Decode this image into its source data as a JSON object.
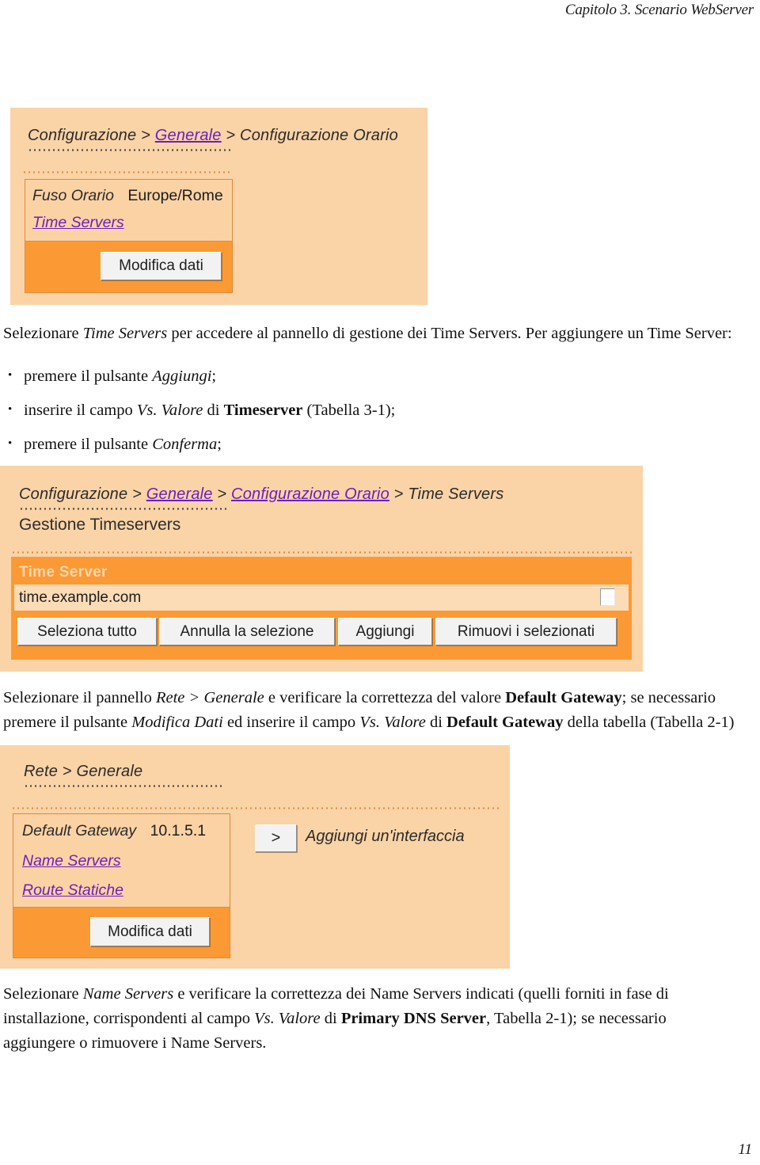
{
  "running_head": "Capitolo 3. Scenario WebServer",
  "page_number": "11",
  "screenshot_timeconfig": {
    "breadcrumb": {
      "part1": "Configurazione",
      "sep1": " > ",
      "link1": "Generale",
      "sep2": " > ",
      "part2": "Configurazione Orario"
    },
    "timezone_label": "Fuso Orario",
    "timezone_value": "Europe/Rome",
    "time_servers_link": "Time Servers",
    "edit_button": "Modifica dati"
  },
  "screenshot_timeservers": {
    "breadcrumb": {
      "part1": "Configurazione",
      "sep1": " > ",
      "link1": "Generale",
      "sep2": " > ",
      "link2": "Configurazione Orario",
      "sep3": " > ",
      "part2": "Time Servers"
    },
    "panel_title": "Gestione Timeservers",
    "table": {
      "header": "Time Server",
      "rows": [
        {
          "server": "time.example.com",
          "selected": false
        }
      ]
    },
    "buttons": [
      "Seleziona tutto",
      "Annulla la selezione",
      "Aggiungi",
      "Rimuovi i selezionati"
    ]
  },
  "screenshot_network": {
    "breadcrumb": {
      "part1": "Rete",
      "sep1": " > ",
      "part2": "Generale"
    },
    "gateway_label": "Default Gateway",
    "gateway_value": "10.1.5.1",
    "name_servers_link": "Name Servers",
    "static_routes_link": "Route Statiche",
    "edit_button": "Modifica dati",
    "add_interface_arrow": ">",
    "add_interface_label": "Aggiungi un'interfaccia"
  },
  "paragraphs": {
    "p1": {
      "s1": "Selezionare ",
      "i1": "Time Servers",
      "s2": " per accedere al pannello di gestione dei Time Servers. Per aggiungere un Time Server:"
    },
    "bullets": [
      {
        "s1": "premere il pulsante ",
        "i1": "Aggiungi",
        "s2": ";"
      },
      {
        "s1": "inserire il campo ",
        "i1": "Vs. Valore",
        "s2": " di ",
        "b1": "Timeserver",
        "s3": " (Tabella 3-1);"
      },
      {
        "s1": "premere il pulsante ",
        "i1": "Conferma",
        "s2": ";"
      }
    ],
    "p2": {
      "s1": "Selezionare il pannello ",
      "i1": "Rete > Generale",
      "s2": " e verificare la correttezza del valore ",
      "b1": "Default Gateway",
      "s3": "; se necessario premere il pulsante ",
      "i2": "Modifica Dati",
      "s4": " ed inserire il campo ",
      "i3": "Vs. Valore",
      "s5": " di ",
      "b2": "Default Gateway",
      "s6": " della tabella (Tabella 2-1)"
    },
    "p3": {
      "s1": "Selezionare ",
      "i1": "Name Servers",
      "s2": " e verificare la correttezza dei Name Servers indicati (quelli forniti in fase di installazione, corrispondenti al campo ",
      "i2": "Vs. Valore",
      "s3": " di ",
      "b1": "Primary DNS Server",
      "s4": ", Tabella 2-1); se necessario aggiungere o rimuovere i Name Servers."
    }
  },
  "colors": {
    "panel_light": "#fad3a6",
    "panel_dark": "#fb9a35",
    "link": "#6c1fc0",
    "border": "#e08a3c"
  }
}
